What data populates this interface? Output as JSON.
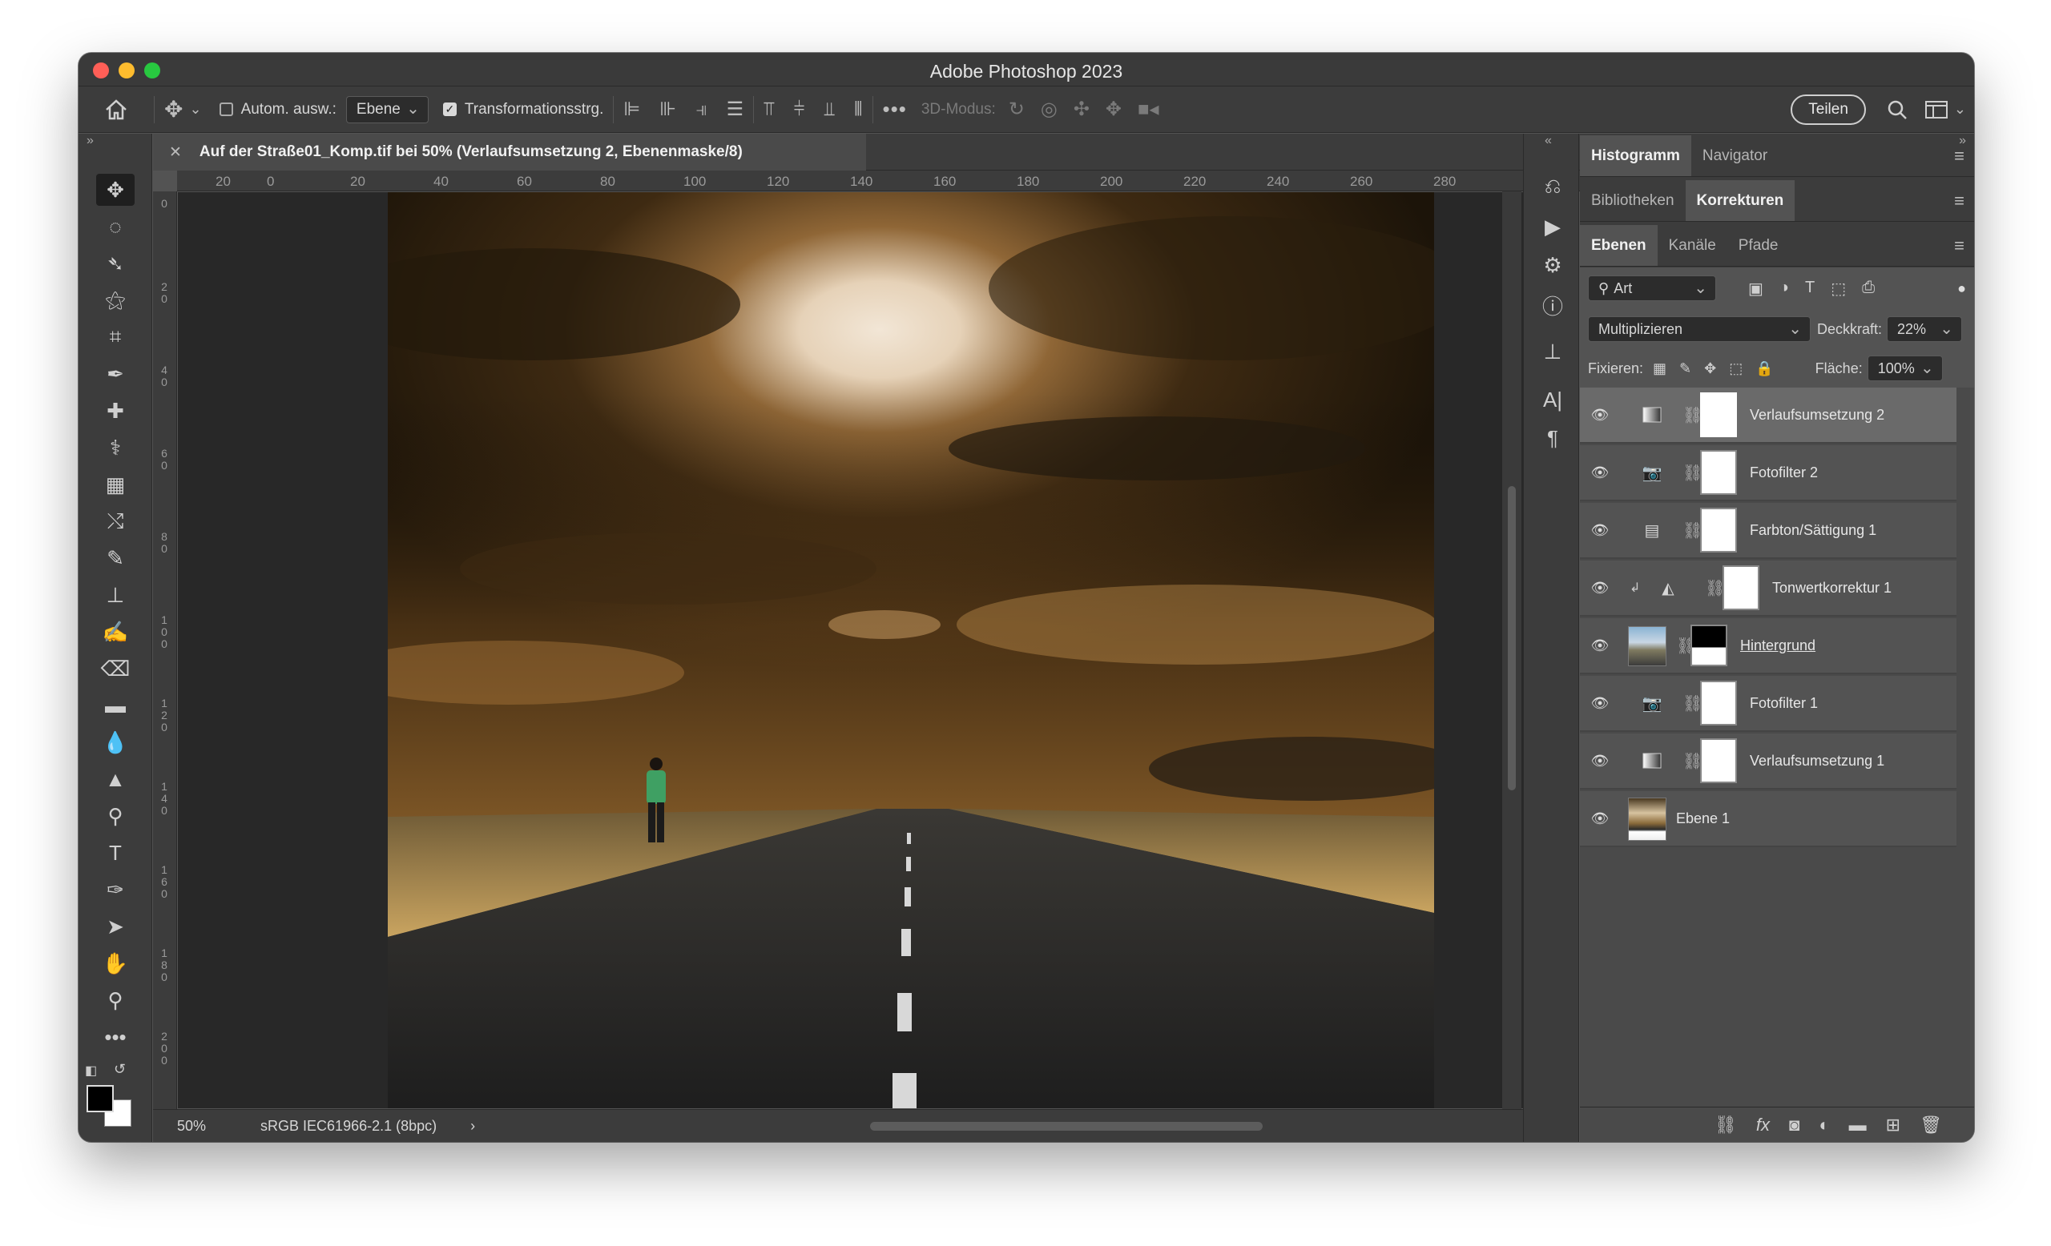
{
  "window": {
    "title": "Adobe Photoshop 2023"
  },
  "options": {
    "auto_select_label": "Autom. ausw.:",
    "auto_select_value": "Ebene",
    "transform_label": "Transformationsstrg.",
    "mode_3d_label": "3D-Modus:",
    "share_label": "Teilen"
  },
  "document": {
    "tab_title": "Auf der Straße01_Komp.tif bei 50% (Verlaufsumsetzung 2, Ebenenmaske/8)",
    "zoom": "50%",
    "color_profile": "sRGB IEC61966-2.1 (8bpc)"
  },
  "ruler": {
    "top": [
      "20",
      "0",
      "20",
      "40",
      "60",
      "80",
      "100",
      "120",
      "140",
      "160",
      "180",
      "200",
      "220",
      "240",
      "260",
      "280"
    ],
    "left": [
      "0",
      "20",
      "40",
      "60",
      "80",
      "100",
      "120",
      "140",
      "160",
      "180",
      "200"
    ]
  },
  "panels": {
    "group1_tabs": [
      "Histogramm",
      "Navigator"
    ],
    "group2_tabs": [
      "Bibliotheken",
      "Korrekturen"
    ],
    "group3_tabs": [
      "Ebenen",
      "Kanäle",
      "Pfade"
    ],
    "filter_kind": "Art",
    "blend_mode": "Multiplizieren",
    "opacity_label": "Deckkraft:",
    "opacity_value": "22%",
    "lock_label": "Fixieren:",
    "fill_label": "Fläche:",
    "fill_value": "100%"
  },
  "layers": [
    {
      "name": "Verlaufsumsetzung 2",
      "icon": "gradient-map-icon",
      "selected": true
    },
    {
      "name": "Fotofilter 2",
      "icon": "photo-filter-icon"
    },
    {
      "name": "Farbton/Sättigung 1",
      "icon": "hue-saturation-icon"
    },
    {
      "name": "Tonwertkorrektur 1",
      "icon": "levels-icon",
      "clipped": true
    },
    {
      "name": "Hintergrund",
      "icon": "photo-thumbnail",
      "black_mask": true
    },
    {
      "name": "Fotofilter 1",
      "icon": "photo-filter-icon"
    },
    {
      "name": "Verlaufsumsetzung 1",
      "icon": "gradient-map-icon"
    },
    {
      "name": "Ebene 1",
      "icon": "photo-thumbnail"
    }
  ]
}
